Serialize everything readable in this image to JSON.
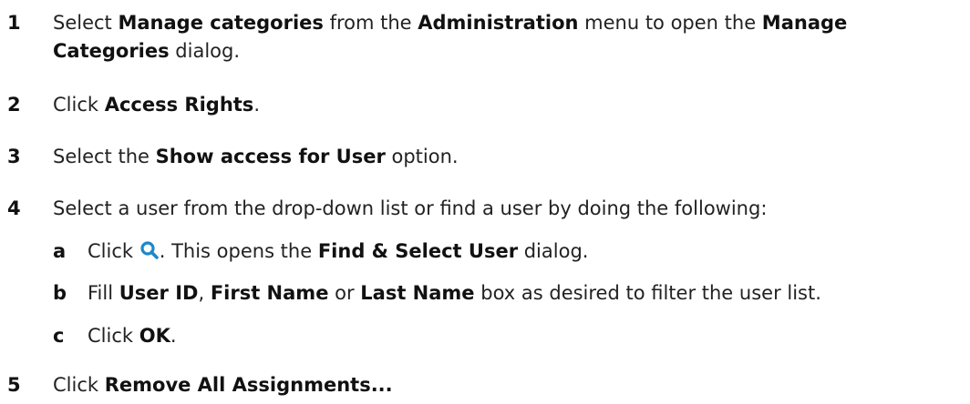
{
  "steps": [
    {
      "num": "1",
      "t1": "Select ",
      "b1": "Manage categories",
      "t2": " from the ",
      "b2": "Administration",
      "t3": " menu to open the ",
      "b3": "Manage",
      "b4": "Categories",
      "t4": " dialog."
    },
    {
      "num": "2",
      "t1": "Click ",
      "b1": "Access Rights",
      "t2": "."
    },
    {
      "num": "3",
      "t1": "Select the ",
      "b1": "Show access for User",
      "t2": " option."
    },
    {
      "num": "4",
      "t1": "Select a user from the drop-down list or find a user by doing the following:",
      "substeps": [
        {
          "num": "a",
          "t1": "Click ",
          "icon": "search-icon",
          "t2": ". This opens the ",
          "b1": "Find & Select User",
          "t3": " dialog."
        },
        {
          "num": "b",
          "t1": "Fill ",
          "b1": "User ID",
          "t2": ", ",
          "b2": "First Name",
          "t3": " or ",
          "b3": "Last Name",
          "t4": " box as desired to filter the user list."
        },
        {
          "num": "c",
          "t1": "Click ",
          "b1": "OK",
          "t2": "."
        }
      ]
    },
    {
      "num": "5",
      "t1": "Click ",
      "b1": "Remove All Assignments..."
    }
  ],
  "colors": {
    "text": "#222222",
    "icon": "#1e88c8"
  }
}
